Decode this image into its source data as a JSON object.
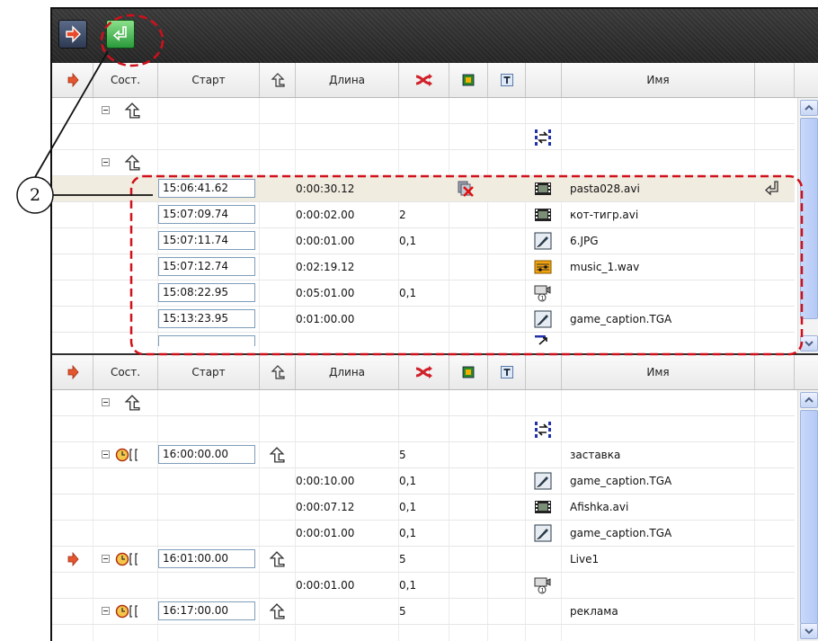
{
  "annotation": {
    "callout_number": "2"
  },
  "toolbar": {
    "buttons": [
      {
        "name": "play-to-air-button",
        "icon": "red-arrow-icon"
      },
      {
        "name": "return-button",
        "icon": "return-arrow-icon"
      }
    ]
  },
  "columns": {
    "state": "Сост.",
    "start": "Старт",
    "length": "Длина",
    "name": "Имя"
  },
  "panel1": {
    "rows": [
      {
        "type": "group-header"
      },
      {
        "type": "separator"
      },
      {
        "type": "group-header"
      },
      {
        "start": "15:06:41.62",
        "length": "0:00:30.12",
        "transition": "",
        "name": "pasta028.avi",
        "icon": "film-icon",
        "flag": "no-graphics-icon",
        "selected": true
      },
      {
        "start": "15:07:09.74",
        "length": "0:00:02.00",
        "transition": "2",
        "name": "кот-тигр.avi",
        "icon": "film-icon"
      },
      {
        "start": "15:07:11.74",
        "length": "0:00:01.00",
        "transition": "0,1",
        "name": "6.JPG",
        "icon": "image-icon"
      },
      {
        "start": "15:07:12.74",
        "length": "0:02:19.12",
        "transition": "",
        "name": "music_1.wav",
        "icon": "audio-icon"
      },
      {
        "start": "15:08:22.95",
        "length": "0:05:01.00",
        "transition": "0,1",
        "name": "",
        "icon": "live-input-icon"
      },
      {
        "start": "15:13:23.95",
        "length": "0:01:00.00",
        "transition": "",
        "name": "game_caption.TGA",
        "icon": "image-icon"
      }
    ]
  },
  "panel2": {
    "rows": [
      {
        "type": "group-header"
      },
      {
        "type": "separator"
      },
      {
        "start": "16:00:00.00",
        "length": "",
        "transition": "5",
        "name": "заставка",
        "icon": "",
        "block": true
      },
      {
        "start": "",
        "length": "0:00:10.00",
        "transition": "0,1",
        "name": "game_caption.TGA",
        "icon": "image-icon"
      },
      {
        "start": "",
        "length": "0:00:07.12",
        "transition": "0,1",
        "name": "Afishka.avi",
        "icon": "film-icon"
      },
      {
        "start": "",
        "length": "0:00:01.00",
        "transition": "0,1",
        "name": "game_caption.TGA",
        "icon": "image-icon"
      },
      {
        "start": "16:01:00.00",
        "length": "",
        "transition": "5",
        "name": "Live1",
        "icon": "",
        "block": true,
        "onair": true
      },
      {
        "start": "",
        "length": "0:00:01.00",
        "transition": "0,1",
        "name": "",
        "icon": "live-input-icon"
      },
      {
        "start": "16:17:00.00",
        "length": "",
        "transition": "5",
        "name": "реклама",
        "icon": "",
        "block": true
      }
    ]
  },
  "colors": {
    "annotation_red": "#d0101a",
    "selected_row": "#f1ece0",
    "toolbar": "#2f2f2f"
  }
}
